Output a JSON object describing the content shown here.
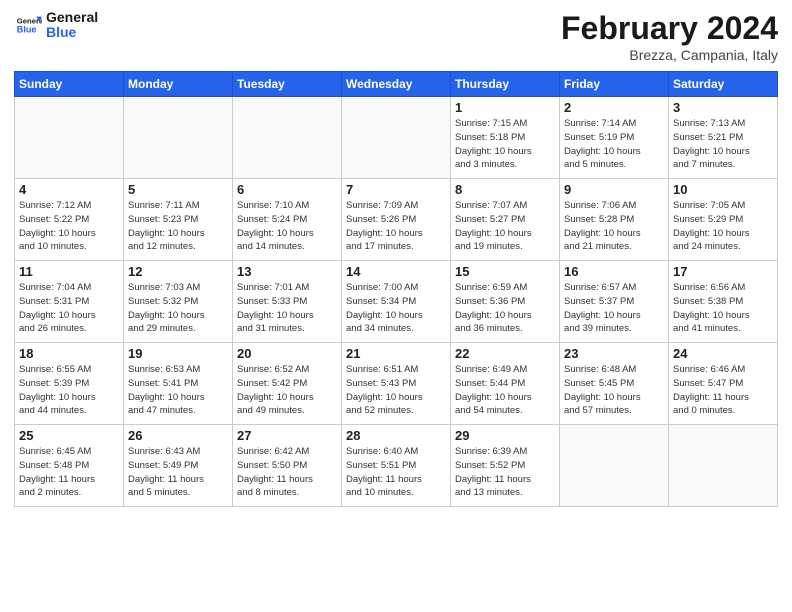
{
  "logo": {
    "line1": "General",
    "line2": "Blue"
  },
  "title": "February 2024",
  "subtitle": "Brezza, Campania, Italy",
  "weekdays": [
    "Sunday",
    "Monday",
    "Tuesday",
    "Wednesday",
    "Thursday",
    "Friday",
    "Saturday"
  ],
  "weeks": [
    [
      {
        "day": "",
        "info": ""
      },
      {
        "day": "",
        "info": ""
      },
      {
        "day": "",
        "info": ""
      },
      {
        "day": "",
        "info": ""
      },
      {
        "day": "1",
        "info": "Sunrise: 7:15 AM\nSunset: 5:18 PM\nDaylight: 10 hours\nand 3 minutes."
      },
      {
        "day": "2",
        "info": "Sunrise: 7:14 AM\nSunset: 5:19 PM\nDaylight: 10 hours\nand 5 minutes."
      },
      {
        "day": "3",
        "info": "Sunrise: 7:13 AM\nSunset: 5:21 PM\nDaylight: 10 hours\nand 7 minutes."
      }
    ],
    [
      {
        "day": "4",
        "info": "Sunrise: 7:12 AM\nSunset: 5:22 PM\nDaylight: 10 hours\nand 10 minutes."
      },
      {
        "day": "5",
        "info": "Sunrise: 7:11 AM\nSunset: 5:23 PM\nDaylight: 10 hours\nand 12 minutes."
      },
      {
        "day": "6",
        "info": "Sunrise: 7:10 AM\nSunset: 5:24 PM\nDaylight: 10 hours\nand 14 minutes."
      },
      {
        "day": "7",
        "info": "Sunrise: 7:09 AM\nSunset: 5:26 PM\nDaylight: 10 hours\nand 17 minutes."
      },
      {
        "day": "8",
        "info": "Sunrise: 7:07 AM\nSunset: 5:27 PM\nDaylight: 10 hours\nand 19 minutes."
      },
      {
        "day": "9",
        "info": "Sunrise: 7:06 AM\nSunset: 5:28 PM\nDaylight: 10 hours\nand 21 minutes."
      },
      {
        "day": "10",
        "info": "Sunrise: 7:05 AM\nSunset: 5:29 PM\nDaylight: 10 hours\nand 24 minutes."
      }
    ],
    [
      {
        "day": "11",
        "info": "Sunrise: 7:04 AM\nSunset: 5:31 PM\nDaylight: 10 hours\nand 26 minutes."
      },
      {
        "day": "12",
        "info": "Sunrise: 7:03 AM\nSunset: 5:32 PM\nDaylight: 10 hours\nand 29 minutes."
      },
      {
        "day": "13",
        "info": "Sunrise: 7:01 AM\nSunset: 5:33 PM\nDaylight: 10 hours\nand 31 minutes."
      },
      {
        "day": "14",
        "info": "Sunrise: 7:00 AM\nSunset: 5:34 PM\nDaylight: 10 hours\nand 34 minutes."
      },
      {
        "day": "15",
        "info": "Sunrise: 6:59 AM\nSunset: 5:36 PM\nDaylight: 10 hours\nand 36 minutes."
      },
      {
        "day": "16",
        "info": "Sunrise: 6:57 AM\nSunset: 5:37 PM\nDaylight: 10 hours\nand 39 minutes."
      },
      {
        "day": "17",
        "info": "Sunrise: 6:56 AM\nSunset: 5:38 PM\nDaylight: 10 hours\nand 41 minutes."
      }
    ],
    [
      {
        "day": "18",
        "info": "Sunrise: 6:55 AM\nSunset: 5:39 PM\nDaylight: 10 hours\nand 44 minutes."
      },
      {
        "day": "19",
        "info": "Sunrise: 6:53 AM\nSunset: 5:41 PM\nDaylight: 10 hours\nand 47 minutes."
      },
      {
        "day": "20",
        "info": "Sunrise: 6:52 AM\nSunset: 5:42 PM\nDaylight: 10 hours\nand 49 minutes."
      },
      {
        "day": "21",
        "info": "Sunrise: 6:51 AM\nSunset: 5:43 PM\nDaylight: 10 hours\nand 52 minutes."
      },
      {
        "day": "22",
        "info": "Sunrise: 6:49 AM\nSunset: 5:44 PM\nDaylight: 10 hours\nand 54 minutes."
      },
      {
        "day": "23",
        "info": "Sunrise: 6:48 AM\nSunset: 5:45 PM\nDaylight: 10 hours\nand 57 minutes."
      },
      {
        "day": "24",
        "info": "Sunrise: 6:46 AM\nSunset: 5:47 PM\nDaylight: 11 hours\nand 0 minutes."
      }
    ],
    [
      {
        "day": "25",
        "info": "Sunrise: 6:45 AM\nSunset: 5:48 PM\nDaylight: 11 hours\nand 2 minutes."
      },
      {
        "day": "26",
        "info": "Sunrise: 6:43 AM\nSunset: 5:49 PM\nDaylight: 11 hours\nand 5 minutes."
      },
      {
        "day": "27",
        "info": "Sunrise: 6:42 AM\nSunset: 5:50 PM\nDaylight: 11 hours\nand 8 minutes."
      },
      {
        "day": "28",
        "info": "Sunrise: 6:40 AM\nSunset: 5:51 PM\nDaylight: 11 hours\nand 10 minutes."
      },
      {
        "day": "29",
        "info": "Sunrise: 6:39 AM\nSunset: 5:52 PM\nDaylight: 11 hours\nand 13 minutes."
      },
      {
        "day": "",
        "info": ""
      },
      {
        "day": "",
        "info": ""
      }
    ]
  ]
}
